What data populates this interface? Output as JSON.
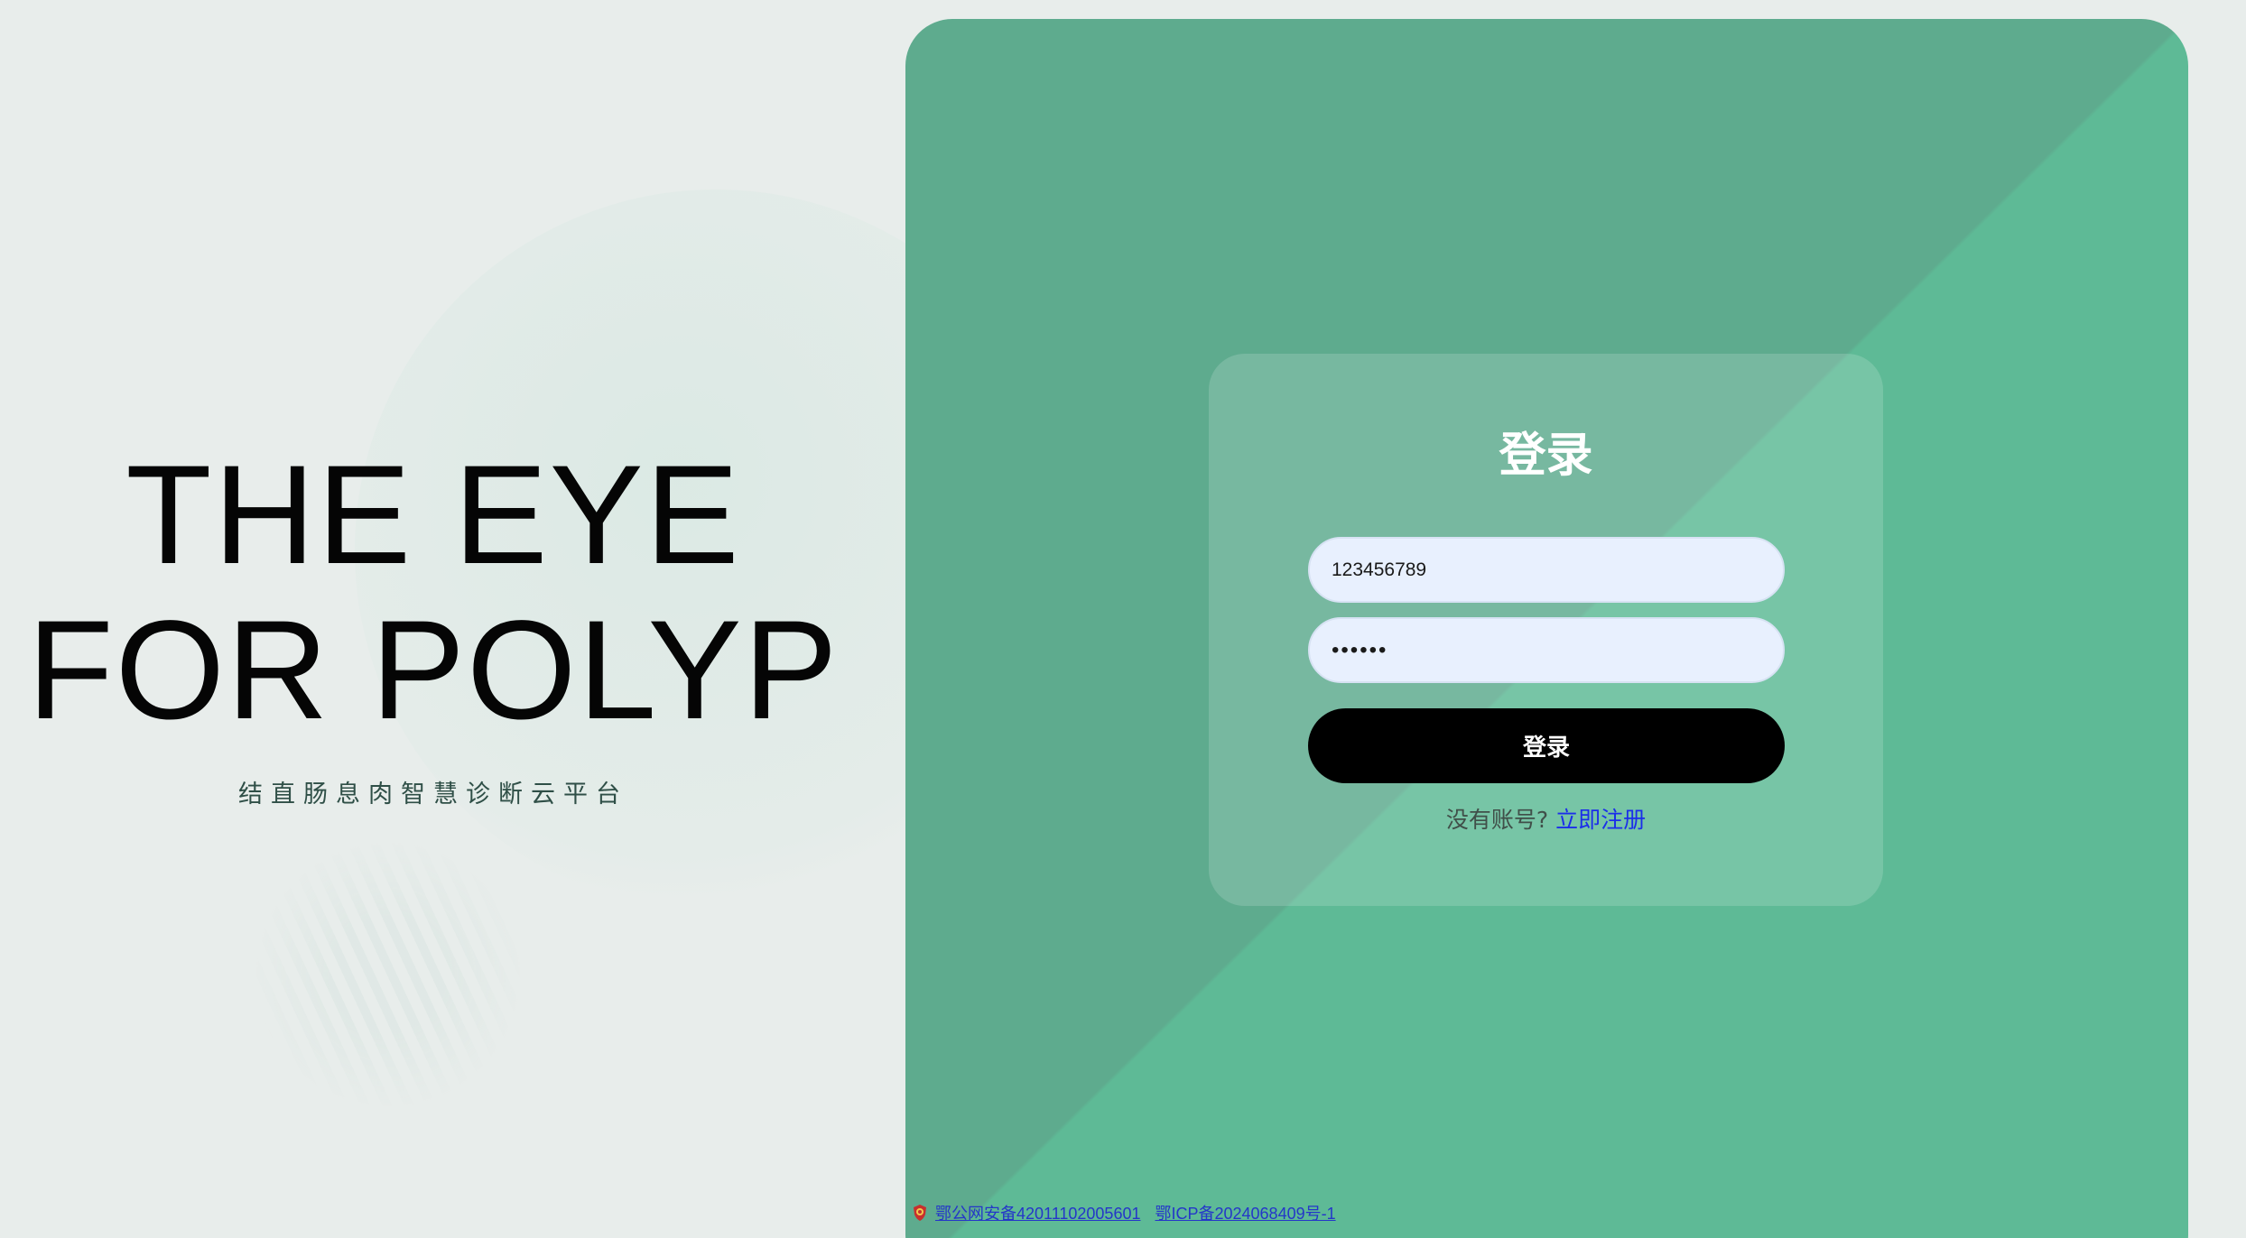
{
  "brand": {
    "line1": "THE EYE",
    "line2": "FOR POLYP",
    "subtitle": "结直肠息肉智慧诊断云平台"
  },
  "login": {
    "title": "登录",
    "username_value": "123456789",
    "password_value": "123456",
    "button_label": "登录",
    "no_account_text": "没有账号?",
    "register_link": "立即注册"
  },
  "footer": {
    "police_icon": "police-badge-icon",
    "public_security_record": "鄂公网安备42011102005601",
    "icp_record": "鄂ICP备2024068409号-1"
  },
  "colors": {
    "background": "#e8edeb",
    "panel_dark": "#5eab8e",
    "panel_light": "#5eba96",
    "button": "#000000",
    "link": "#1b2eea"
  }
}
